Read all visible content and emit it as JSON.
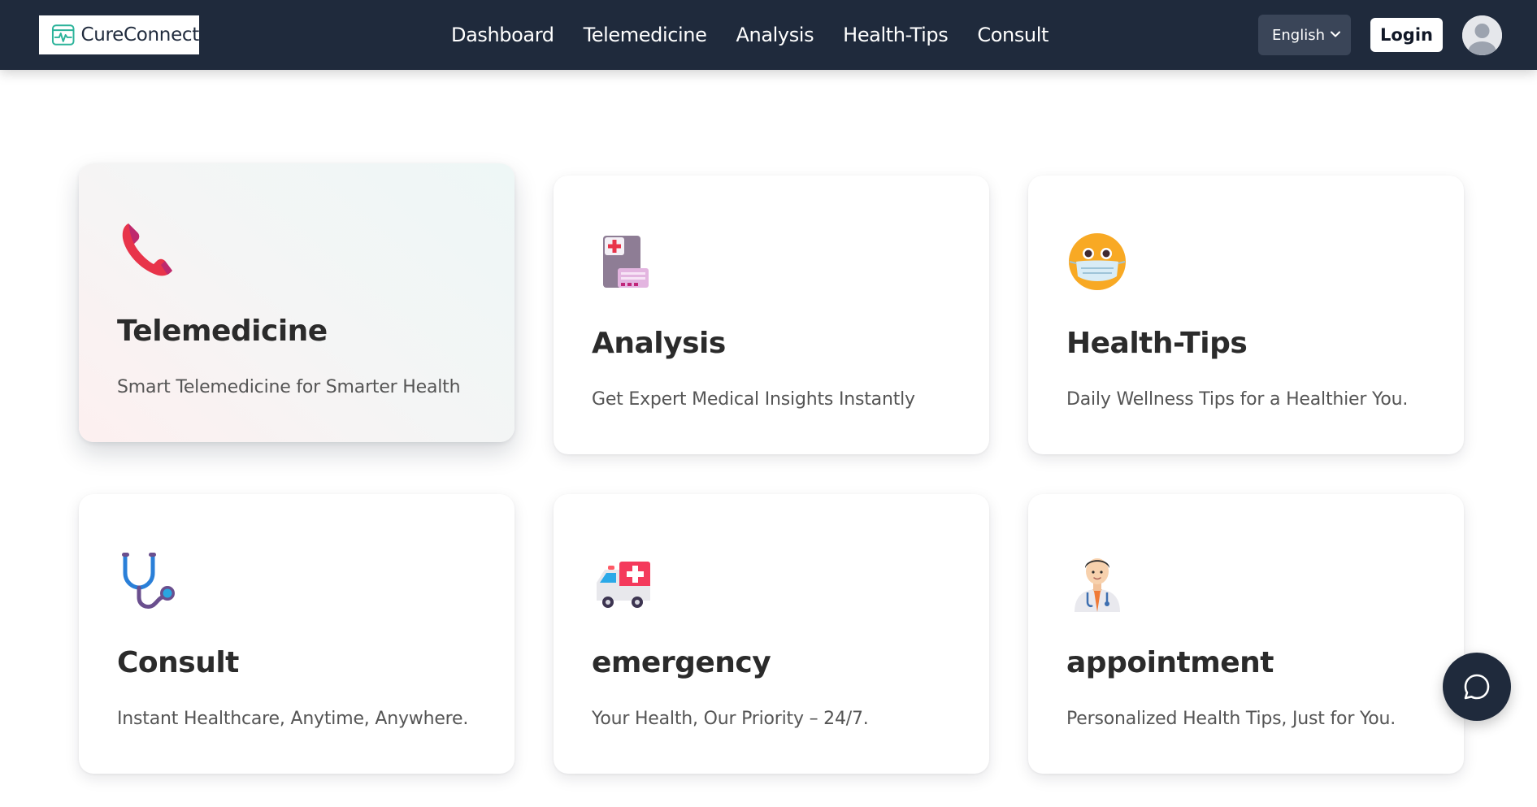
{
  "navbar": {
    "brand": "CureConnect",
    "links": [
      {
        "label": "Dashboard"
      },
      {
        "label": "Telemedicine"
      },
      {
        "label": "Analysis"
      },
      {
        "label": "Health-Tips"
      },
      {
        "label": "Consult"
      }
    ],
    "language": "English",
    "login_label": "Login"
  },
  "cards": [
    {
      "title": "Telemedicine",
      "description": "Smart Telemedicine for Smarter Health",
      "icon": "telephone-receiver-icon"
    },
    {
      "title": "Analysis",
      "description": "Get Expert Medical Insights Instantly",
      "icon": "medical-report-icon"
    },
    {
      "title": "Health-Tips",
      "description": "Daily Wellness Tips for a Healthier You.",
      "icon": "face-with-medical-mask-icon"
    },
    {
      "title": "Consult",
      "description": "Instant Healthcare, Anytime, Anywhere.",
      "icon": "stethoscope-icon"
    },
    {
      "title": "emergency",
      "description": "Your Health, Our Priority – 24/7.",
      "icon": "ambulance-icon"
    },
    {
      "title": "appointment",
      "description": "Personalized Health Tips, Just for You.",
      "icon": "doctor-icon"
    }
  ],
  "chat": {
    "icon": "chat-bubble-icon"
  },
  "colors": {
    "navbar_bg": "#1f2a3c",
    "brand_accent": "#2bb39a",
    "card_title": "#2b2b2b",
    "card_text": "#555555"
  }
}
